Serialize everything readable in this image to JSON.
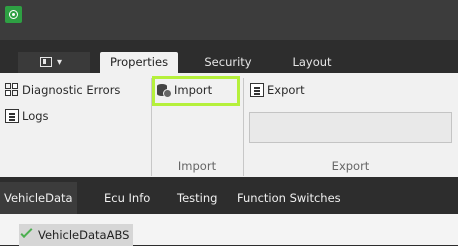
{
  "ribbon": {
    "tabs": [
      "Properties",
      "Security",
      "Layout"
    ],
    "active_tab": "Properties"
  },
  "ribbon_items": {
    "diagnostic_errors": "Diagnostic Errors",
    "logs": "Logs",
    "import": "Import",
    "export": "Export"
  },
  "groups": {
    "import_label": "Import",
    "export_label": "Export",
    "export_field_value": ""
  },
  "document_tabs": [
    "VehicleData",
    "Ecu Info",
    "Testing",
    "Function Switches"
  ],
  "active_document_tab": "VehicleData",
  "sub_tab": {
    "label": "VehicleDataABS",
    "status": "valid"
  },
  "colors": {
    "highlight": "#b5f03b",
    "app_icon": "#2ea043",
    "status_check": "#4caf50"
  },
  "icons": {
    "app": "app-logo-icon",
    "menu": "menu-icon",
    "diagnostic": "grid-icon",
    "logs": "document-icon",
    "import": "database-import-icon",
    "export": "document-export-icon",
    "check": "check-icon"
  }
}
